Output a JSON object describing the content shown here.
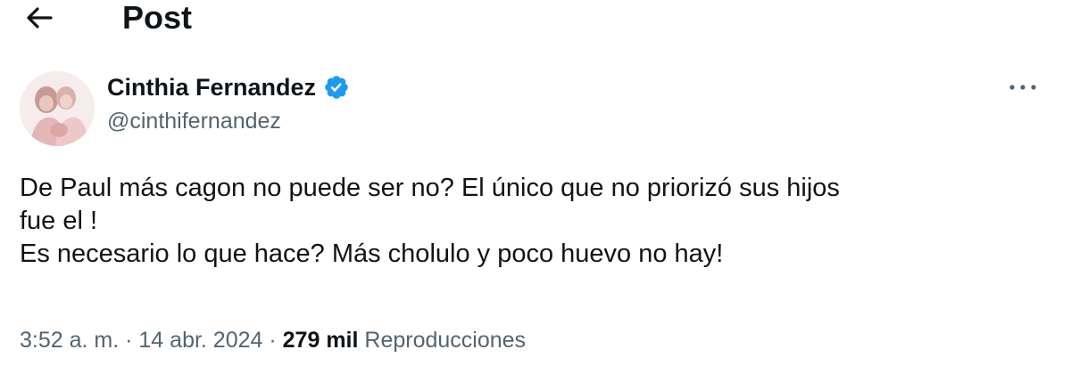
{
  "header": {
    "back_icon": "arrow-left-icon",
    "title": "Post"
  },
  "author": {
    "avatar_icon": "profile-photo-avatar",
    "name": "Cinthia Fernandez",
    "verified_icon": "verified-badge-icon",
    "verified_color": "#1d9bf0",
    "handle": "@cinthifernandez"
  },
  "menu": {
    "more_icon": "more-horizontal-icon"
  },
  "post": {
    "lines": [
      "De Paul más cagon no puede ser no? El único que no priorizó sus hijos",
      "fue el !",
      "Es necesario lo que hace? Más cholulo y poco huevo no hay!"
    ]
  },
  "meta": {
    "time": "3:52 a. m.",
    "separator": "·",
    "date": "14 abr. 2024",
    "views_count": "279 mil",
    "views_label": "Reproducciones"
  }
}
